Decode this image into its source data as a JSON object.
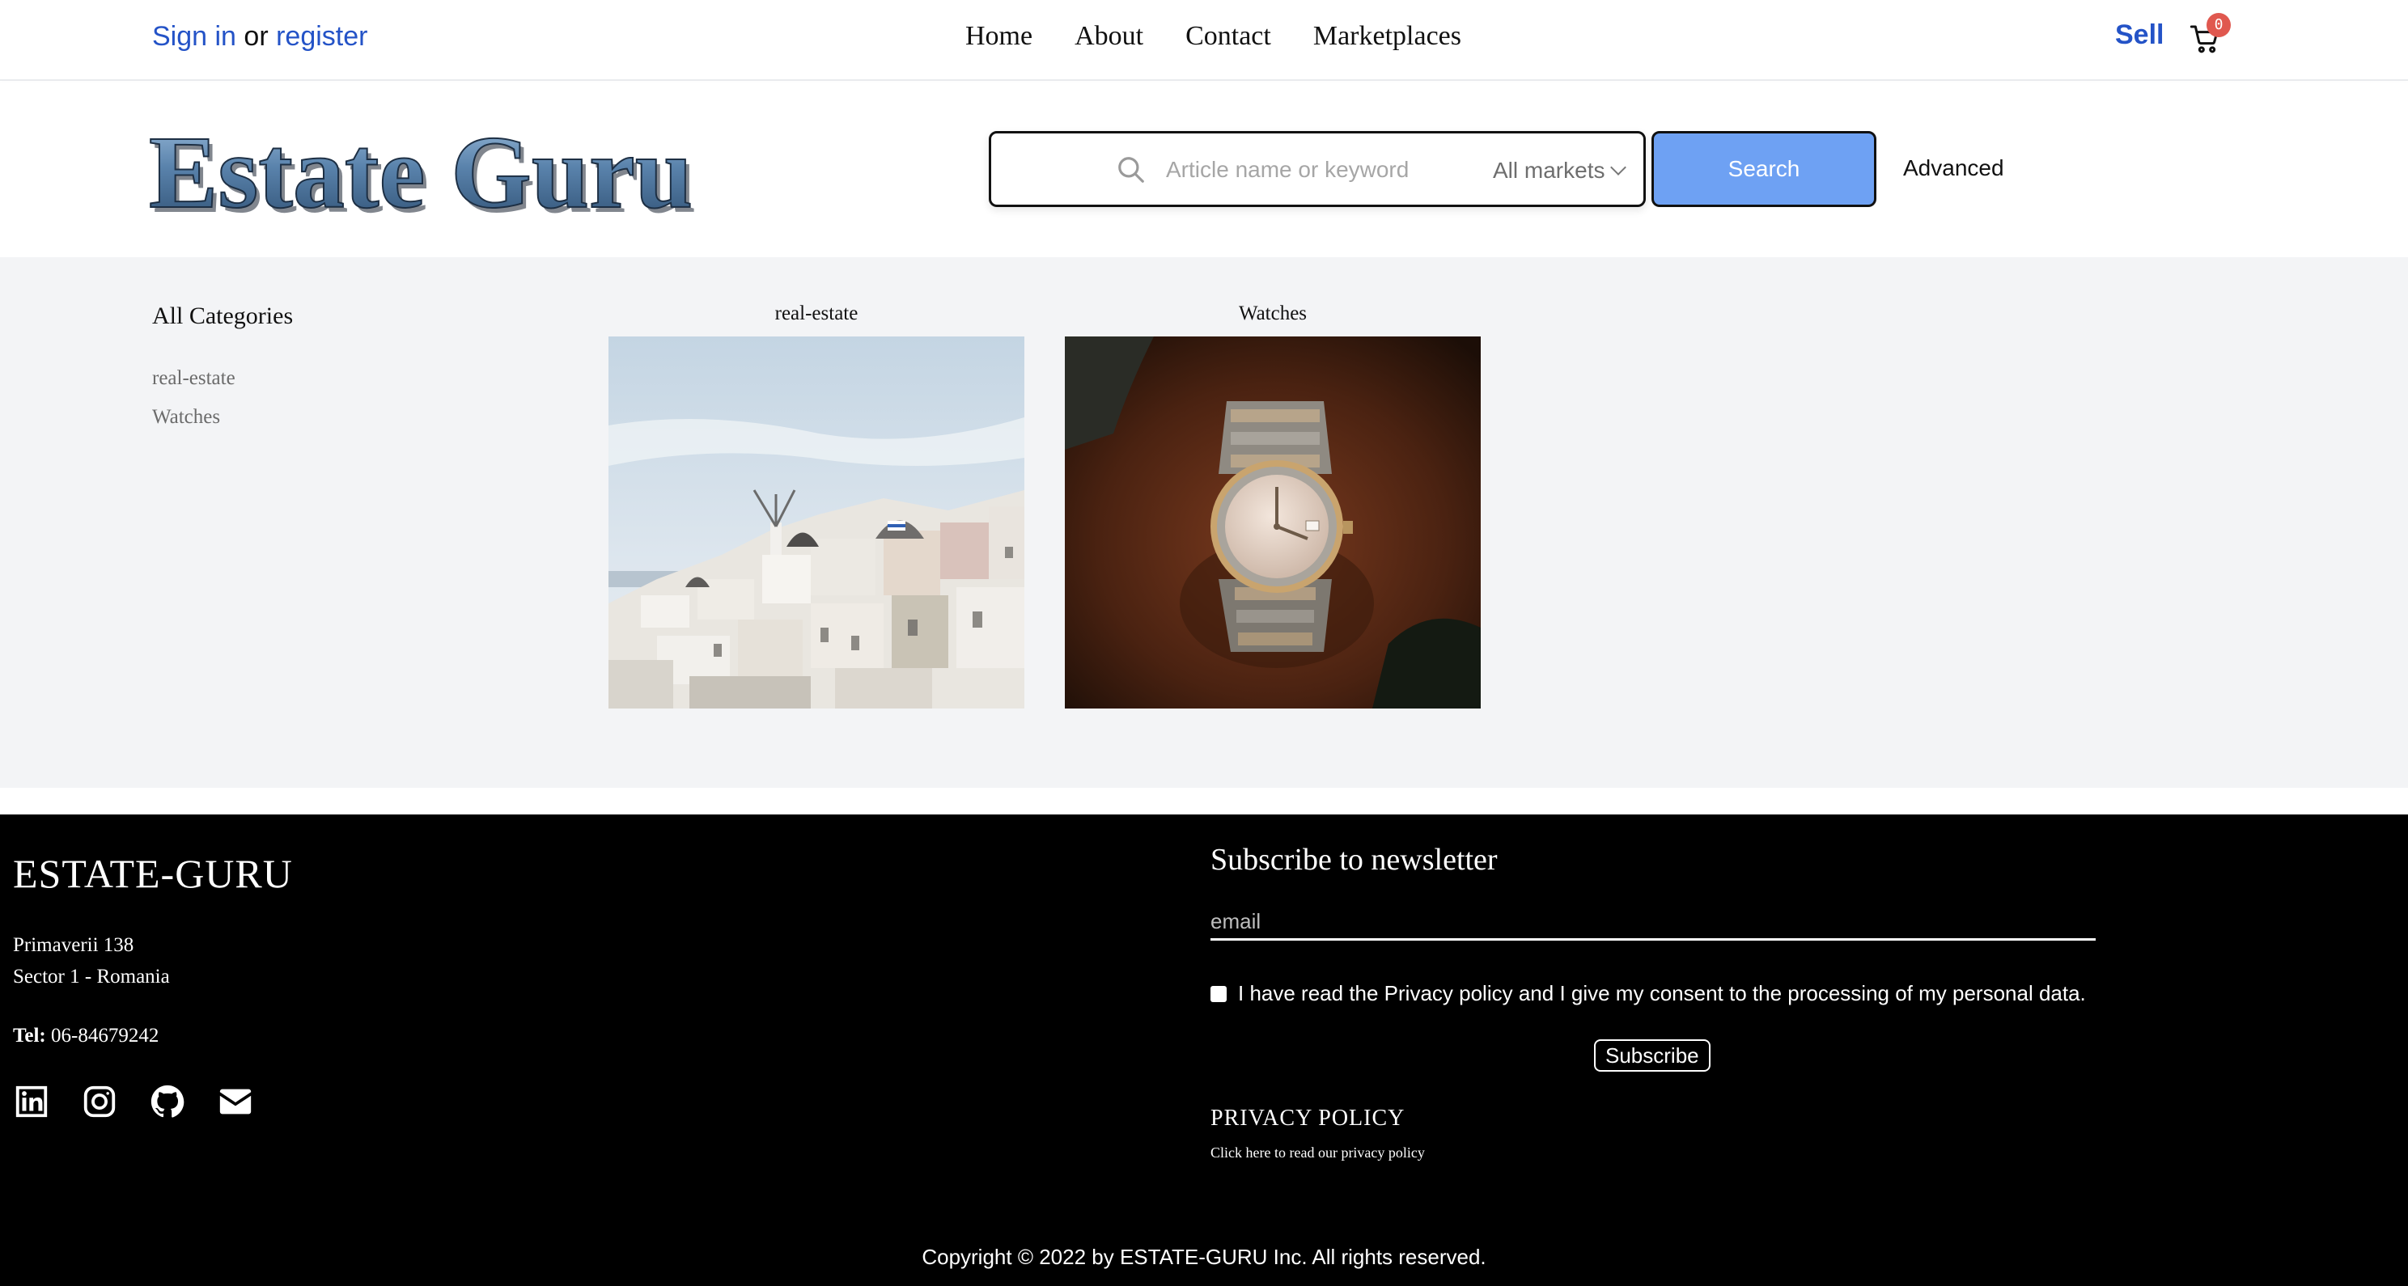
{
  "topbar": {
    "sign_in": "Sign in",
    "or": "or",
    "register": "register",
    "nav": [
      "Home",
      "About",
      "Contact",
      "Marketplaces"
    ],
    "sell": "Sell",
    "cart_count": "0",
    "cart_icon": "shopping-cart-icon"
  },
  "header": {
    "logo_text": "Estate Guru",
    "search": {
      "placeholder": "Article name or keyword",
      "value": "",
      "icon": "search-icon",
      "markets_selected": "All markets",
      "button": "Search"
    },
    "advanced": "Advanced"
  },
  "main": {
    "categories_title": "All Categories",
    "categories": [
      "real-estate",
      "Watches"
    ],
    "cards": [
      {
        "title": "real-estate",
        "image": "santorini-village-photo"
      },
      {
        "title": "Watches",
        "image": "wristwatch-photo"
      }
    ]
  },
  "footer": {
    "brand": "ESTATE-GURU",
    "address_line1": "Primaverii 138",
    "address_line2": "Sector 1 - Romania",
    "tel_label": "Tel:",
    "tel_value": "06-84679242",
    "social_icons": [
      "linkedin-icon",
      "instagram-icon",
      "github-icon",
      "envelope-icon"
    ],
    "newsletter_title": "Subscribe to newsletter",
    "email_placeholder": "email",
    "consent_text": "I have read the Privacy policy and I give my consent to the processing of my personal data.",
    "consent_checked": false,
    "subscribe_button": "Subscribe",
    "privacy_title": "PRIVACY POLICY",
    "privacy_link": "Click here to read our privacy policy",
    "copyright": "Copyright © 2022 by ESTATE-GURU Inc. All rights reserved."
  },
  "colors": {
    "link_blue": "#2453c7",
    "search_button": "#6ea1f3",
    "cart_badge": "#e0584f",
    "main_background": "#f3f4f6",
    "footer_background": "#000000"
  }
}
